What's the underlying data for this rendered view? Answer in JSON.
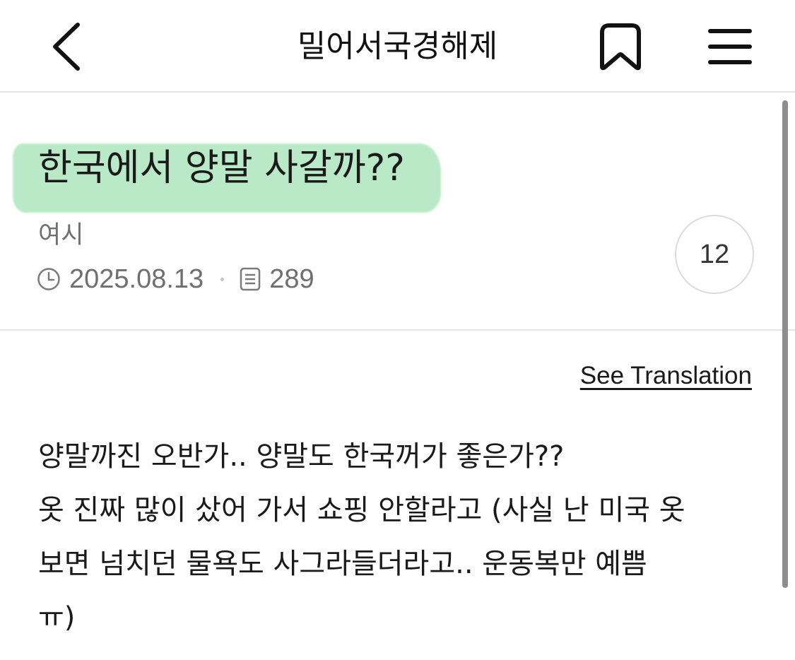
{
  "header": {
    "title": "밀어서국경해제",
    "back_icon": "chevron-left-icon",
    "bookmark_icon": "bookmark-icon",
    "menu_icon": "hamburger-menu-icon"
  },
  "post": {
    "title": "한국에서 양말 사갈까??",
    "author": "여시",
    "date": "2025.08.13",
    "views": "289",
    "comment_count": "12",
    "highlight_color": "#b6e8c4"
  },
  "translation": {
    "label": "See Translation"
  },
  "body": {
    "lines": [
      "양말까진 오반가.. 양말도 한국꺼가 좋은가??",
      "옷 진짜 많이 샀어 가서 쇼핑 안할라고 (사실 난 미국 옷",
      "보면 넘치던 물욕도 사그라들더라고.. 운동복만 예쁨",
      "ㅠ)"
    ]
  }
}
